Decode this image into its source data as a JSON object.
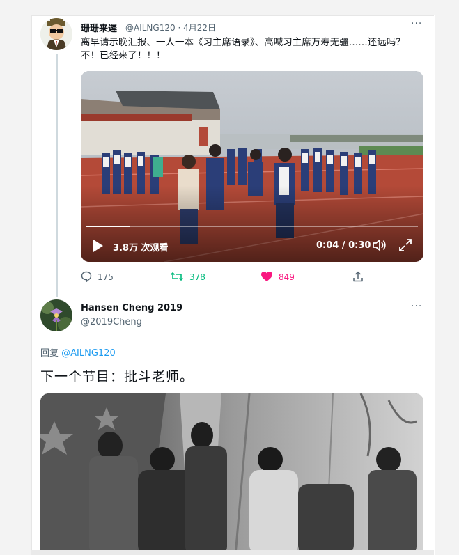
{
  "tweet1": {
    "display_name": "珊珊来遲",
    "handle": "@AILNG120",
    "separator": "·",
    "date": "4月22日",
    "more": "···",
    "text": "离早请示晚汇报、一人一本《习主席语录》、高喊习主席万寿无疆……还远吗？不！已经来了！！！",
    "video": {
      "views": "3.8万 次观看",
      "time": "0:04 / 0:30",
      "progress": 0.13
    },
    "actions": {
      "reply_count": "175",
      "retweet_count": "378",
      "like_count": "849"
    }
  },
  "tweet2": {
    "display_name": "Hansen Cheng 2019",
    "handle": "@2019Cheng",
    "more": "···",
    "reply_prefix": "回复",
    "reply_handle": "@AILNG120",
    "text": "下一个节目：批斗老师。"
  },
  "colors": {
    "accent": "#1d9bf0",
    "retweet": "#00ba7c",
    "like": "#f91880",
    "secondary_text": "#536471"
  },
  "icons": [
    "reply-icon",
    "retweet-icon",
    "like-icon",
    "share-icon",
    "play-icon",
    "volume-icon",
    "fullscreen-icon",
    "more-icon"
  ]
}
